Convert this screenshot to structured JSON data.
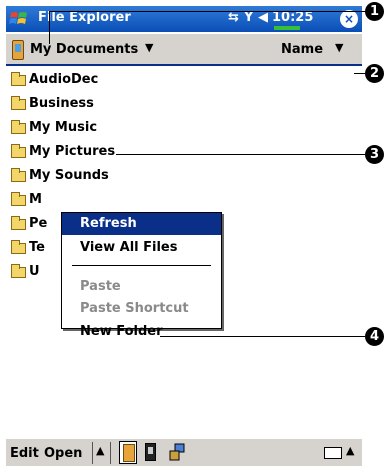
{
  "titlebar": {
    "title": "File Explorer",
    "time": "10:25",
    "close_label": "×"
  },
  "header": {
    "folder": "My Documents",
    "sort": "Name"
  },
  "files": [
    {
      "name": "AudioDec"
    },
    {
      "name": "Business"
    },
    {
      "name": "My Music"
    },
    {
      "name": "My Pictures"
    },
    {
      "name": "My Sounds"
    },
    {
      "name": "M"
    },
    {
      "name": "Pe"
    },
    {
      "name": "Te"
    },
    {
      "name": "U"
    }
  ],
  "context_menu": {
    "refresh": "Refresh",
    "view_all": "View All Files",
    "paste": "Paste",
    "paste_shortcut": "Paste Shortcut",
    "new_folder": "New Folder"
  },
  "menubar": {
    "edit": "Edit",
    "open": "Open"
  },
  "callouts": [
    "1",
    "2",
    "3",
    "4"
  ],
  "colors": {
    "titlebar": "#0a4eb6",
    "highlight": "#0a2f88",
    "disabled_text": "#8a8a8a",
    "bar_gray": "#d6d3ce"
  }
}
